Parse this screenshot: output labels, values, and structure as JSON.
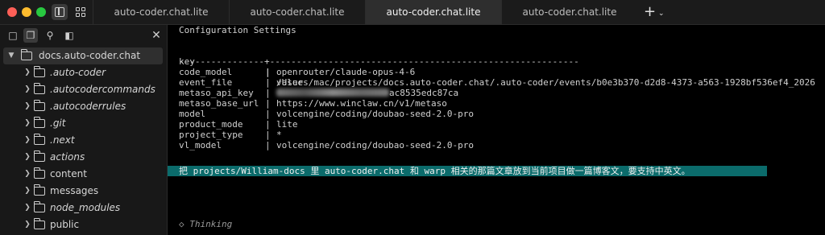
{
  "tabs": [
    {
      "label": "auto-coder.chat.lite",
      "active": false
    },
    {
      "label": "auto-coder.chat.lite",
      "active": false
    },
    {
      "label": "auto-coder.chat.lite",
      "active": true
    },
    {
      "label": "auto-coder.chat.lite",
      "active": false
    }
  ],
  "toolbar": {
    "new_tab_icon": "plus-icon",
    "new_tab_menu_icon": "chevron-down-icon"
  },
  "sidebar": {
    "tools": [
      "chat-icon",
      "files-icon",
      "search-icon",
      "panel-icon"
    ],
    "root": {
      "label": "docs.auto-coder.chat",
      "expanded": true
    },
    "items": [
      {
        "label": ".auto-coder",
        "italic": true
      },
      {
        "label": ".autocodercommands",
        "italic": true
      },
      {
        "label": ".autocoderrules",
        "italic": true
      },
      {
        "label": ".git",
        "italic": true
      },
      {
        "label": ".next",
        "italic": true
      },
      {
        "label": "actions",
        "italic": true
      },
      {
        "label": "content",
        "italic": false
      },
      {
        "label": "messages",
        "italic": false
      },
      {
        "label": "node_modules",
        "italic": true
      },
      {
        "label": "public",
        "italic": false
      }
    ]
  },
  "terminal": {
    "heading": "Configuration Settings",
    "col_key": "key",
    "col_value": "value",
    "divider": "----------------+----------------------------------------------------------",
    "rows": [
      {
        "key": "code_model",
        "value": "openrouter/claude-opus-4-6"
      },
      {
        "key": "event_file",
        "value": "/Users/mac/projects/docs.auto-coder.chat/.auto-coder/events/b0e3b370-d2d8-4373-a563-1928bf536ef4_2026"
      },
      {
        "key": "metaso_api_key",
        "value": "ac8535edc87ca"
      },
      {
        "key": "metaso_base_url",
        "value": "https://www.winclaw.cn/v1/metaso"
      },
      {
        "key": "model",
        "value": "volcengine/coding/doubao-seed-2.0-pro"
      },
      {
        "key": "product_mode",
        "value": "lite"
      },
      {
        "key": "project_type",
        "value": "*"
      },
      {
        "key": "vl_model",
        "value": "volcengine/coding/doubao-seed-2.0-pro"
      }
    ],
    "prompt": "把 projects/William-docs 里 auto-coder.chat 和 warp 相关的那篇文章放到当前项目做一篇博客文，要支持中英文。",
    "thinking": "◇ Thinking",
    "prompt_highlight_color": "#0b6b6b"
  }
}
